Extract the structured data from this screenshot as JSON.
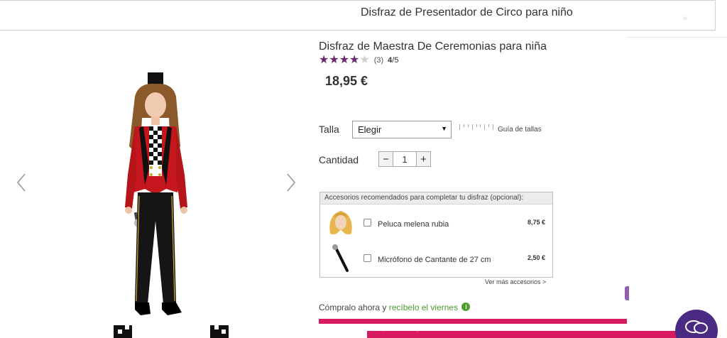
{
  "header": {
    "title": "Disfraz de Presentador de Circo para niño"
  },
  "gallery": {
    "prev_icon": "chevron-left-icon",
    "next_icon": "chevron-right-icon"
  },
  "product": {
    "title": "Disfraz de Maestra De Ceremonias para niña",
    "rating": {
      "stars": 4,
      "max": 5,
      "count": "(3)",
      "score": "4",
      "score_max": "/5"
    },
    "price": "18,95 €"
  },
  "size": {
    "label": "Talla",
    "selected": "Elegir",
    "guide_label": "Guía de tallas"
  },
  "quantity": {
    "label": "Cantidad",
    "value": "1",
    "minus": "−",
    "plus": "+"
  },
  "accessories": {
    "heading": "Accesorios recomendados para completar tu disfraz (opcional):",
    "items": [
      {
        "name": "Peluca melena rubia",
        "price": "8,75 €"
      },
      {
        "name": "Micrófono de Cantante de 27 cm",
        "price": "2,50 €"
      }
    ],
    "more": "Ver más accesorios >"
  },
  "shipping": {
    "prefix": "Cómpralo ahora y ",
    "highlight": "recíbelo el viernes",
    "info_icon": "i"
  },
  "footer": {
    "overlay_text": "Cómpralo ahora y recíbelo el viernes"
  },
  "colors": {
    "accent": "#d81b60",
    "star": "#6b2a6e",
    "green": "#4e9d2d",
    "chat": "#4a2a83"
  }
}
